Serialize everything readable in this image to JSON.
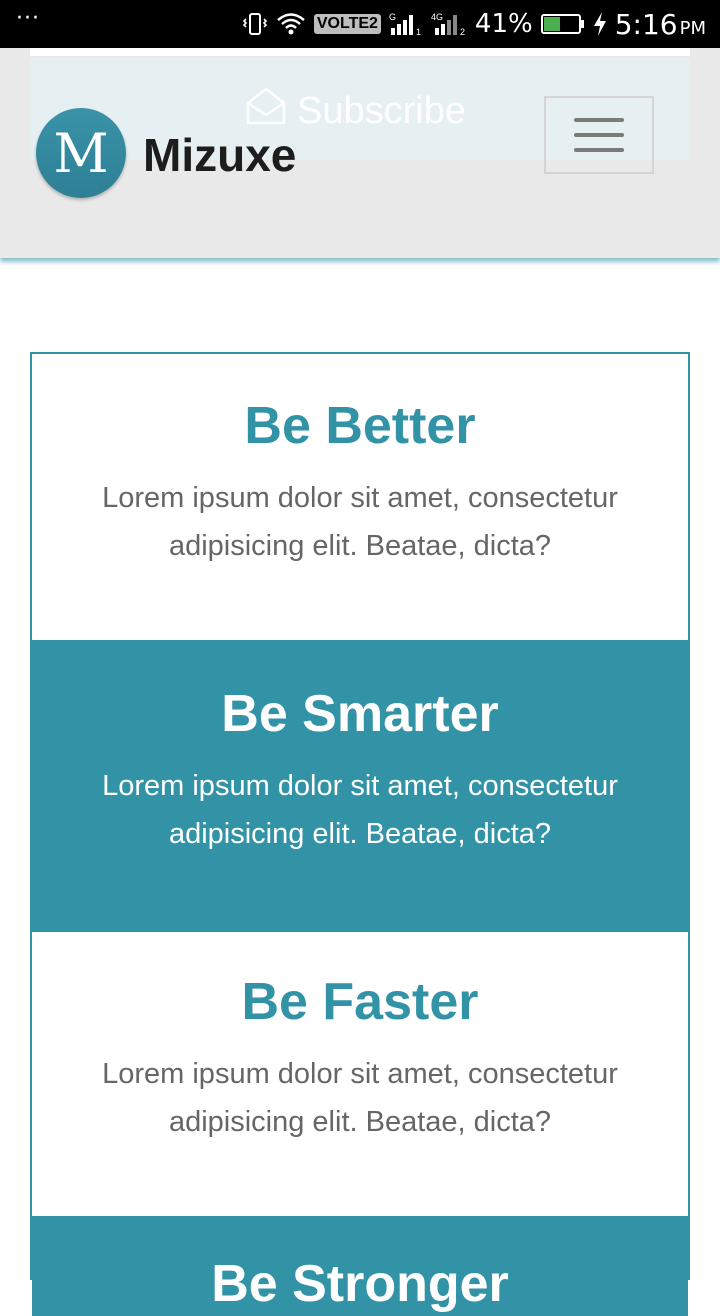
{
  "status_bar": {
    "overflow": "···",
    "volte": "VOLTE2",
    "net1_label": "G",
    "net2_label": "4G",
    "battery": "41%",
    "time": "5:16",
    "ampm": "PM"
  },
  "header": {
    "subscribe_label": "Subscribe",
    "logo_letter": "M",
    "brand": "Mizuxe"
  },
  "features": [
    {
      "title": "Be Better",
      "text": "Lorem ipsum dolor sit amet, consectetur adipisicing elit. Beatae, dicta?"
    },
    {
      "title": "Be Smarter",
      "text": "Lorem ipsum dolor sit amet, consectetur adipisicing elit. Beatae, dicta?"
    },
    {
      "title": "Be Faster",
      "text": "Lorem ipsum dolor sit amet, consectetur adipisicing elit. Beatae, dicta?"
    },
    {
      "title": "Be Stronger",
      "text": ""
    }
  ],
  "colors": {
    "accent": "#3292a6",
    "header_bg": "#e9e9e9",
    "text_gray": "#666666"
  },
  "icons": [
    "vibrate-icon",
    "wifi-icon",
    "signal-icon",
    "battery-icon",
    "charging-icon",
    "envelope-icon",
    "hamburger-menu-icon"
  ]
}
